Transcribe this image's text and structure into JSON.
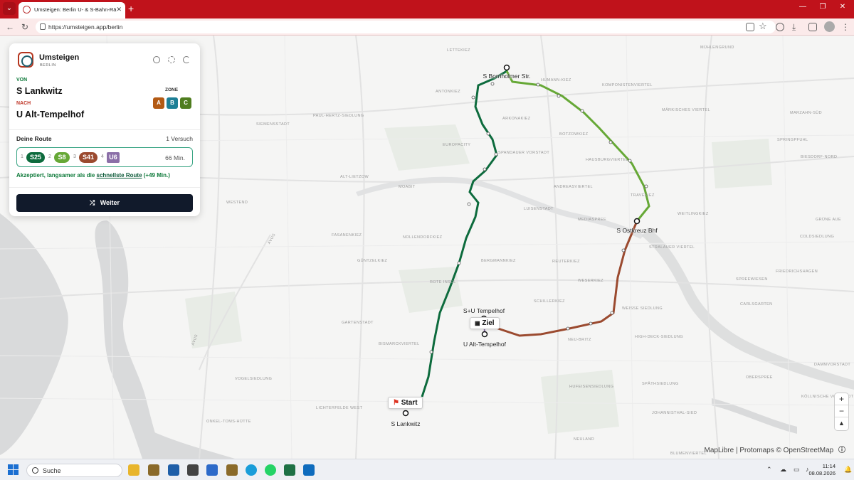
{
  "browser": {
    "tab_title": "Umsteigen: Berlin U- & S-Bahn-Rä",
    "url": "https://umsteigen.app/berlin"
  },
  "panel": {
    "app_title": "Umsteigen",
    "app_subtitle": "BERLIN",
    "von_label": "VON",
    "from": "S Lankwitz",
    "nach_label": "NACH",
    "to": "U Alt-Tempelhof",
    "zone_label": "ZONE",
    "zones": [
      {
        "label": "A",
        "color": "#b35a14"
      },
      {
        "label": "B",
        "color": "#1d7f96"
      },
      {
        "label": "C",
        "color": "#4f7d1f"
      }
    ],
    "route_label": "Deine Route",
    "attempts": "1 Versuch",
    "route": [
      {
        "num": "1",
        "line": "S25",
        "color": "#0d6b3d"
      },
      {
        "num": "2",
        "line": "S8",
        "color": "#66a836"
      },
      {
        "num": "3",
        "line": "S41",
        "color": "#9b4a2f"
      },
      {
        "num": "4",
        "line": "U6",
        "color": "#8b6fa8"
      }
    ],
    "duration": "66 Min.",
    "accepted_prefix": "Akzeptiert, langsamer als die ",
    "accepted_link": "schnellste Route",
    "accepted_suffix": " (+49 Min.)",
    "weiter_label": "Weiter"
  },
  "map": {
    "stations": {
      "bornholmer": "S Bornholmer Str.",
      "ostkreuz": "S Ostkreuz Bhf",
      "tempelhof": "S+U Tempelhof",
      "alt_tempelhof": "U Alt-Tempelhof",
      "lankwitz": "S Lankwitz"
    },
    "ziel_label": "Ziel",
    "start_label": "Start",
    "districts": [
      "MÜHLENGRUND",
      "LETTEKIEZ",
      "ANTONKIEZ",
      "HUMANN-KIEZ",
      "KOMPONISTENVIERTEL",
      "ARKONAKIEZ",
      "BOTZOWKIEZ",
      "MÄRKISCHES VIERTEL",
      "MARZAHN-SÜD",
      "PAUL-HERTZ-SIEDLUNG",
      "SIEMENSSTADT",
      "EUROPACITY",
      "SPANDAUER VORSTADT",
      "HAUSBURGVIERTEL",
      "SPRINGPFUHL",
      "BIESDORF-NORD",
      "ALT-LIETZOW",
      "MOABIT",
      "ANDREASVIERTEL",
      "TRAVEKIEZ",
      "LUISENSTADT",
      "MEDIASPREE",
      "WEITLINGKIEZ",
      "GRÜNE AUE",
      "FASANENKIEZ",
      "NOLLENDORFKIEZ",
      "STRALAUER VIERTEL",
      "COLDSIEDLUNG",
      "GÜNTZELKIEZ",
      "BERGMANNKIEZ",
      "REUTERKIEZ",
      "SCHILLERKIEZ",
      "WESERKIEZ",
      "ROTE INSEL",
      "FRIEDRICHSHAGEN",
      "SPREEWIESEN",
      "GARTENSTADT",
      "WEISSE SIEDLUNG",
      "CARLSGARTEN",
      "BISMARCKVIERTEL",
      "NEU-BRITZ",
      "HIGH-DECK-SIEDLUNG",
      "DAMMVORSTADT",
      "OBERSPREE",
      "HUFEISENSIEDLUNG",
      "SPÄTHSIEDLUNG",
      "LICHTERFELDE WEST",
      "JOHANNISTHAL-SIED",
      "NEULAND",
      "BLUMENVIERTEL",
      "KÖLLNISCHE VORSTADT",
      "VOGELSIEDLUNG",
      "ONKEL-TOMS-HÜTTE",
      "WESTEND"
    ],
    "road_labels": [
      "AVUS",
      "AVUS"
    ],
    "attribution": "MapLibre | Protomaps © OpenStreetMap",
    "zoom_in": "+",
    "zoom_out": "−",
    "compass": "▲"
  },
  "taskbar": {
    "search_placeholder": "Suche",
    "time": "11:14",
    "date": "08.08.2026"
  }
}
